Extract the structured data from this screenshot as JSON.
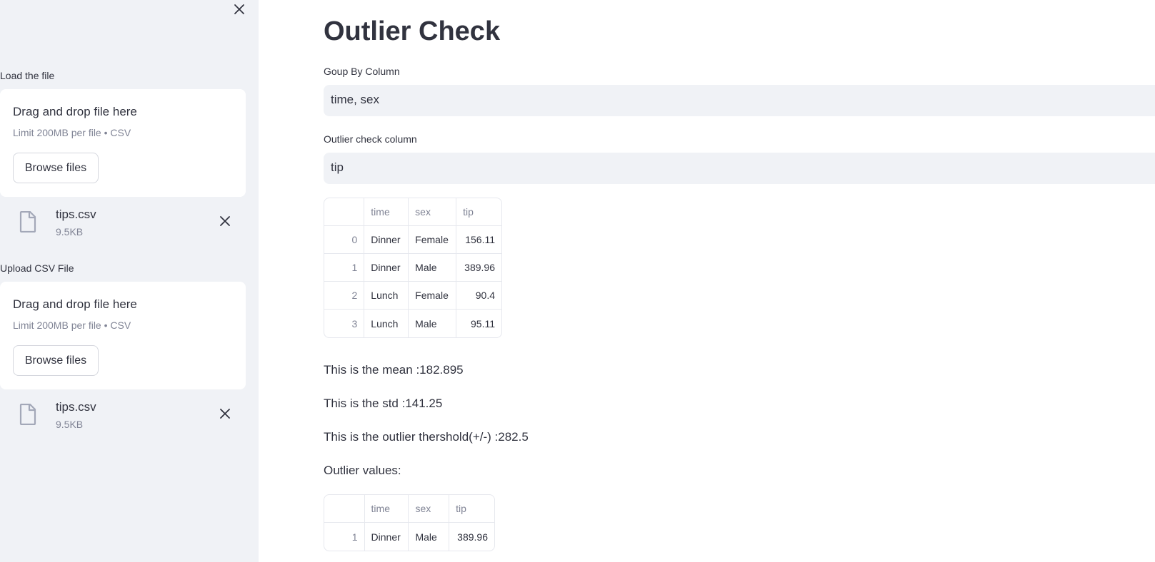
{
  "sidebar": {
    "uploaders": [
      {
        "label": "Load the file",
        "drop_title": "Drag and drop file here",
        "limit": "Limit 200MB per file • CSV",
        "browse_label": "Browse files",
        "file": {
          "name": "tips.csv",
          "size": "9.5KB"
        }
      },
      {
        "label": "Upload CSV File",
        "drop_title": "Drag and drop file here",
        "limit": "Limit 200MB per file • CSV",
        "browse_label": "Browse files",
        "file": {
          "name": "tips.csv",
          "size": "9.5KB"
        }
      }
    ]
  },
  "main": {
    "title": "Outlier Check",
    "group_by": {
      "label": "Goup By Column",
      "value": "time, sex"
    },
    "outlier_column": {
      "label": "Outlier check column",
      "value": "tip"
    },
    "summary_table": {
      "columns": [
        "",
        "time",
        "sex",
        "tip"
      ],
      "rows": [
        [
          "0",
          "Dinner",
          "Female",
          "156.11"
        ],
        [
          "1",
          "Dinner",
          "Male",
          "389.96"
        ],
        [
          "2",
          "Lunch",
          "Female",
          "90.4"
        ],
        [
          "3",
          "Lunch",
          "Male",
          "95.11"
        ]
      ]
    },
    "stats": {
      "mean": "This is the mean :182.895",
      "std": "This is the std :141.25",
      "threshold": "This is the outlier thershold(+/-) :282.5",
      "outlier_heading": "Outlier values:"
    },
    "outlier_table": {
      "columns": [
        "",
        "time",
        "sex",
        "tip"
      ],
      "rows": [
        [
          "1",
          "Dinner",
          "Male",
          "389.96"
        ]
      ]
    }
  },
  "icons": {
    "close": "close-icon",
    "file": "file-icon",
    "remove": "close-icon"
  },
  "colors": {
    "sidebar_bg": "#f0f2f6",
    "text": "#31333f",
    "muted": "#808495",
    "icon_file": "#a3a8b8"
  }
}
